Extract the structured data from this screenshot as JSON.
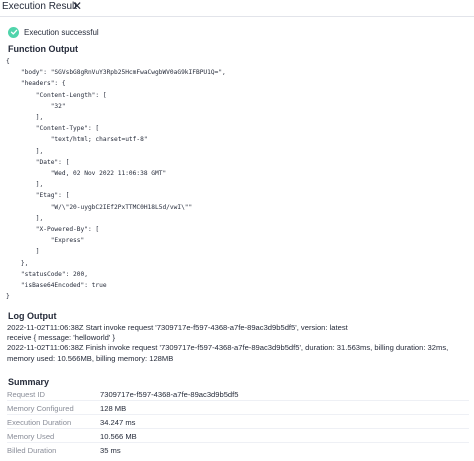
{
  "tab": {
    "title": "Execution Result",
    "close_glyph": "✕"
  },
  "status": {
    "text": "Execution successful",
    "icon": "check-circle-icon",
    "color": "#50d4ab"
  },
  "function_output": {
    "heading": "Function Output",
    "lines": [
      "{",
      "    \"body\": \"SGVsbG8gRnVuY3Rpb25HcmFwaCwgbWV0aG9kIFBPU1Q=\",",
      "    \"headers\": {",
      "        \"Content-Length\": [",
      "            \"32\"",
      "        ],",
      "        \"Content-Type\": [",
      "            \"text/html; charset=utf-8\"",
      "        ],",
      "        \"Date\": [",
      "            \"Wed, 02 Nov 2022 11:06:38 GMT\"",
      "        ],",
      "        \"Etag\": [",
      "            \"W/\\\"20-uygbC2IEf2PxTTMC0H18L5d/vwI\\\"\"",
      "        ],",
      "        \"X-Powered-By\": [",
      "            \"Express\"",
      "        ]",
      "    },",
      "    \"statusCode\": 200,",
      "    \"isBase64Encoded\": true",
      "}"
    ]
  },
  "log_output": {
    "heading": "Log Output",
    "lines": [
      "2022-11-02T11:06:38Z Start invoke request '7309717e-f597-4368-a7fe-89ac3d9b5df5', version: latest",
      "receive { message: 'helloworld' }",
      "2022-11-02T11:06:38Z Finish invoke request '7309717e-f597-4368-a7fe-89ac3d9b5df5', duration: 31.563ms, billing duration: 32ms, memory used: 10.566MB, billing memory: 128MB"
    ]
  },
  "summary": {
    "heading": "Summary",
    "rows": [
      {
        "label": "Request ID",
        "value": "7309717e-f597-4368-a7fe-89ac3d9b5df5"
      },
      {
        "label": "Memory Configured",
        "value": "128 MB"
      },
      {
        "label": "Execution Duration",
        "value": "34.247 ms"
      },
      {
        "label": "Memory Used",
        "value": "10.566 MB"
      },
      {
        "label": "Billed Duration",
        "value": "35 ms"
      }
    ]
  }
}
